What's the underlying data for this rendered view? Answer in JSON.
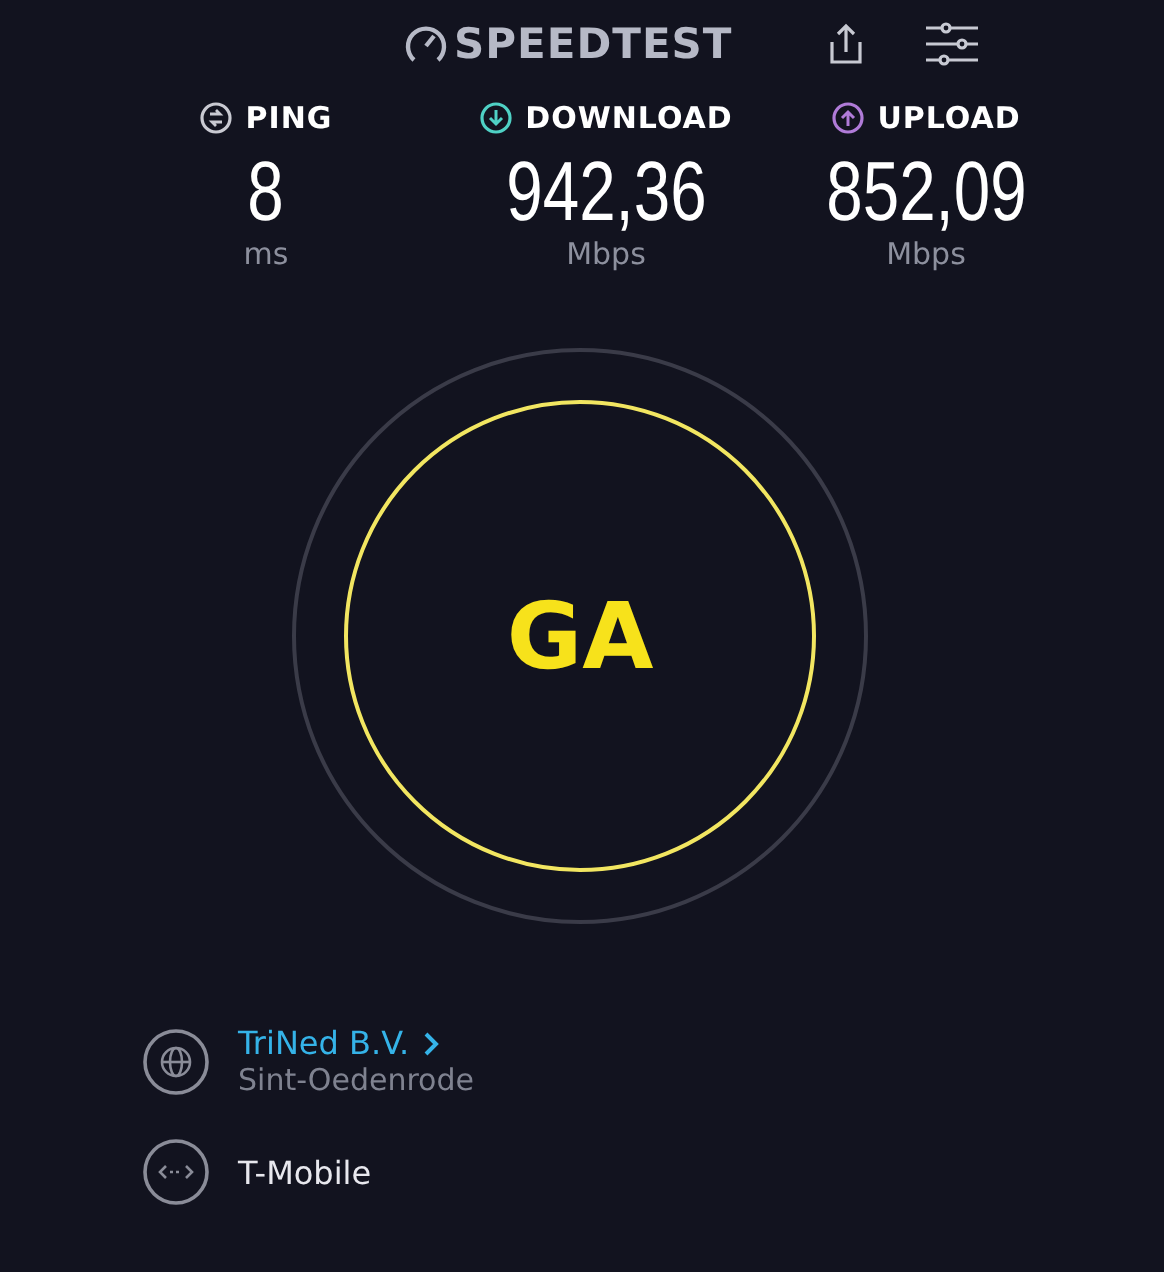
{
  "header": {
    "logo": "SPEEDTEST"
  },
  "metrics": [
    {
      "kind": "ping",
      "label": "PING",
      "value": "8",
      "unit": "ms"
    },
    {
      "kind": "download",
      "label": "DOWNLOAD",
      "value": "942,36",
      "unit": "Mbps"
    },
    {
      "kind": "upload",
      "label": "UPLOAD",
      "value": "852,09",
      "unit": "Mbps"
    }
  ],
  "go_button": {
    "label": "GA"
  },
  "connections": [
    {
      "kind": "isp",
      "name": "TriNed B.V.",
      "location": "Sint-Oedenrode"
    },
    {
      "kind": "carrier",
      "name": "T-Mobile"
    }
  ]
}
